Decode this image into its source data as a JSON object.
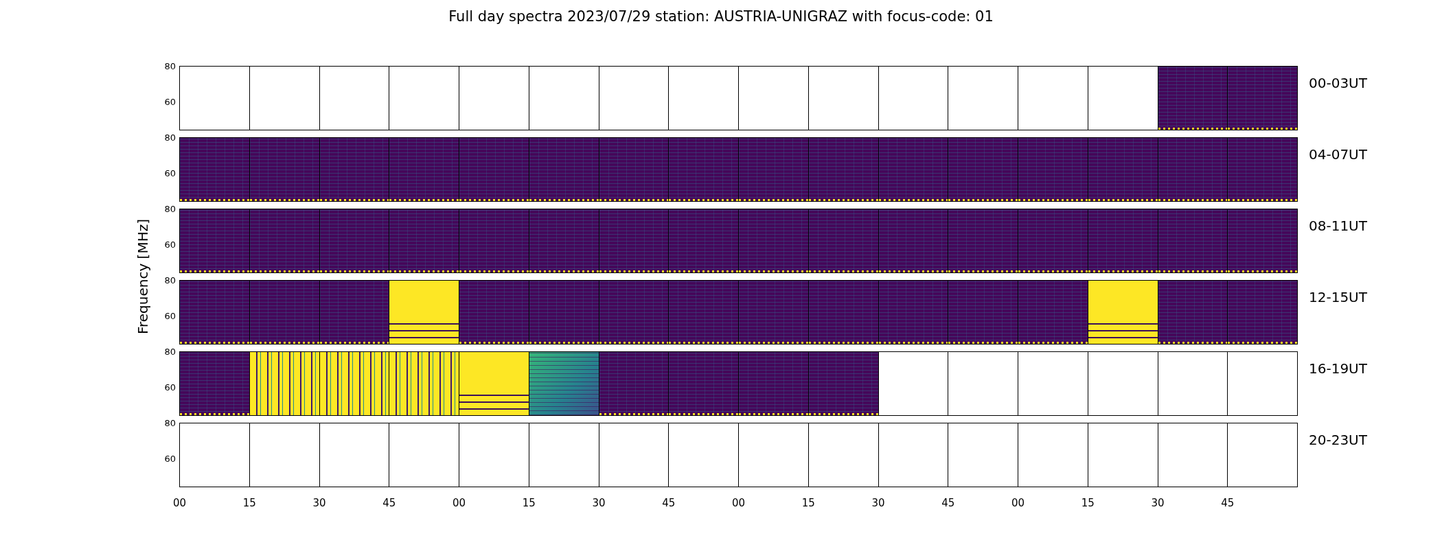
{
  "title": "Full day spectra 2023/07/29 station: AUSTRIA-UNIGRAZ with focus-code: 01",
  "ylabel": "Frequency [MHz]",
  "rows": [
    {
      "label": "00-03UT",
      "yticks": [
        "80",
        "60"
      ],
      "panels": [
        {
          "kind": "empty"
        },
        {
          "kind": "empty"
        },
        {
          "kind": "empty"
        },
        {
          "kind": "empty"
        },
        {
          "kind": "empty"
        },
        {
          "kind": "empty"
        },
        {
          "kind": "empty"
        },
        {
          "kind": "empty"
        },
        {
          "kind": "empty"
        },
        {
          "kind": "empty"
        },
        {
          "kind": "empty"
        },
        {
          "kind": "empty"
        },
        {
          "kind": "empty"
        },
        {
          "kind": "empty"
        },
        {
          "kind": "spectrum"
        },
        {
          "kind": "spectrum"
        }
      ]
    },
    {
      "label": "04-07UT",
      "yticks": [
        "80",
        "60"
      ],
      "panels": [
        {
          "kind": "spectrum"
        },
        {
          "kind": "spectrum"
        },
        {
          "kind": "spectrum"
        },
        {
          "kind": "spectrum"
        },
        {
          "kind": "spectrum"
        },
        {
          "kind": "spectrum"
        },
        {
          "kind": "spectrum"
        },
        {
          "kind": "spectrum"
        },
        {
          "kind": "spectrum"
        },
        {
          "kind": "spectrum"
        },
        {
          "kind": "spectrum"
        },
        {
          "kind": "spectrum"
        },
        {
          "kind": "spectrum"
        },
        {
          "kind": "spectrum"
        },
        {
          "kind": "spectrum"
        },
        {
          "kind": "spectrum"
        }
      ]
    },
    {
      "label": "08-11UT",
      "yticks": [
        "80",
        "60"
      ],
      "panels": [
        {
          "kind": "spectrum"
        },
        {
          "kind": "spectrum"
        },
        {
          "kind": "spectrum"
        },
        {
          "kind": "spectrum"
        },
        {
          "kind": "spectrum"
        },
        {
          "kind": "spectrum"
        },
        {
          "kind": "spectrum"
        },
        {
          "kind": "spectrum"
        },
        {
          "kind": "spectrum"
        },
        {
          "kind": "spectrum"
        },
        {
          "kind": "spectrum"
        },
        {
          "kind": "spectrum"
        },
        {
          "kind": "spectrum"
        },
        {
          "kind": "spectrum"
        },
        {
          "kind": "spectrum"
        },
        {
          "kind": "spectrum"
        }
      ]
    },
    {
      "label": "12-15UT",
      "yticks": [
        "80",
        "60"
      ],
      "panels": [
        {
          "kind": "spectrum"
        },
        {
          "kind": "spectrum"
        },
        {
          "kind": "spectrum"
        },
        {
          "kind": "saturated"
        },
        {
          "kind": "spectrum"
        },
        {
          "kind": "spectrum"
        },
        {
          "kind": "spectrum"
        },
        {
          "kind": "spectrum"
        },
        {
          "kind": "spectrum"
        },
        {
          "kind": "spectrum"
        },
        {
          "kind": "spectrum"
        },
        {
          "kind": "spectrum"
        },
        {
          "kind": "spectrum"
        },
        {
          "kind": "saturated"
        },
        {
          "kind": "spectrum"
        },
        {
          "kind": "spectrum"
        }
      ]
    },
    {
      "label": "16-19UT",
      "yticks": [
        "80",
        "60"
      ],
      "panels": [
        {
          "kind": "spectrum"
        },
        {
          "kind": "striped"
        },
        {
          "kind": "striped"
        },
        {
          "kind": "striped"
        },
        {
          "kind": "saturated"
        },
        {
          "kind": "bright"
        },
        {
          "kind": "spectrum"
        },
        {
          "kind": "spectrum"
        },
        {
          "kind": "spectrum"
        },
        {
          "kind": "spectrum"
        },
        {
          "kind": "empty"
        },
        {
          "kind": "empty"
        },
        {
          "kind": "empty"
        },
        {
          "kind": "empty"
        },
        {
          "kind": "empty"
        },
        {
          "kind": "empty"
        }
      ]
    },
    {
      "label": "20-23UT",
      "yticks": [
        "80",
        "60"
      ],
      "panels": [
        {
          "kind": "empty"
        },
        {
          "kind": "empty"
        },
        {
          "kind": "empty"
        },
        {
          "kind": "empty"
        },
        {
          "kind": "empty"
        },
        {
          "kind": "empty"
        },
        {
          "kind": "empty"
        },
        {
          "kind": "empty"
        },
        {
          "kind": "empty"
        },
        {
          "kind": "empty"
        },
        {
          "kind": "empty"
        },
        {
          "kind": "empty"
        },
        {
          "kind": "empty"
        },
        {
          "kind": "empty"
        },
        {
          "kind": "empty"
        },
        {
          "kind": "empty"
        }
      ]
    }
  ],
  "xticks": [
    "00",
    "15",
    "30",
    "45",
    "00",
    "15",
    "30",
    "45",
    "00",
    "15",
    "30",
    "45",
    "00",
    "15",
    "30",
    "45"
  ]
}
